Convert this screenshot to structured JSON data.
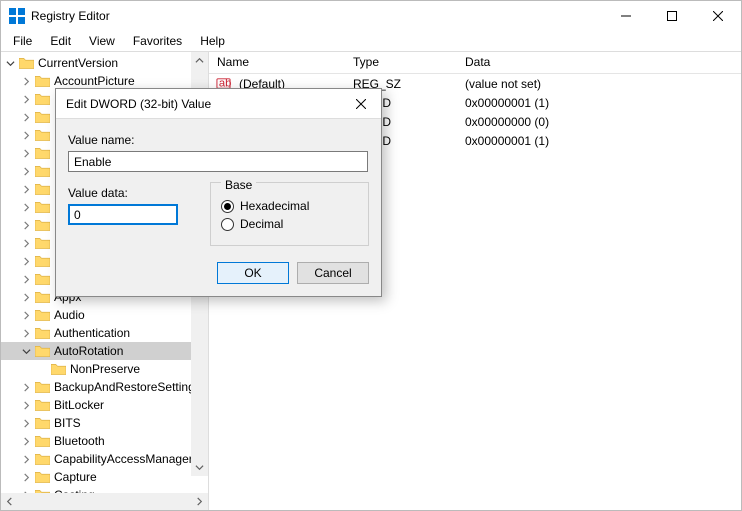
{
  "titlebar": {
    "title": "Registry Editor"
  },
  "menubar": {
    "file": "File",
    "edit": "Edit",
    "view": "View",
    "favorites": "Favorites",
    "help": "Help"
  },
  "tree": {
    "root_label": "CurrentVersion",
    "items": [
      "AccountPicture",
      "",
      "",
      "",
      "",
      "",
      "",
      "",
      "",
      "",
      "",
      "",
      "Appx",
      "Audio",
      "Authentication",
      "AutoRotation",
      "BackupAndRestoreSettings",
      "BitLocker",
      "BITS",
      "Bluetooth",
      "CapabilityAccessManager",
      "Capture",
      "Casting"
    ],
    "auto_rotation_children": [
      "NonPreserve"
    ]
  },
  "list": {
    "columns": {
      "name": "Name",
      "type": "Type",
      "data": "Data"
    },
    "rows": [
      {
        "name": "(Default)",
        "type": "REG_SZ",
        "data": "(value not set)",
        "icon": "string"
      },
      {
        "name": "",
        "type": "WORD",
        "data": "0x00000001 (1)",
        "icon": ""
      },
      {
        "name": "",
        "type": "WORD",
        "data": "0x00000000 (0)",
        "icon": ""
      },
      {
        "name": "",
        "type": "WORD",
        "data": "0x00000001 (1)",
        "icon": ""
      }
    ]
  },
  "dialog": {
    "title": "Edit DWORD (32-bit) Value",
    "value_name_label": "Value name:",
    "value_name": "Enable",
    "value_data_label": "Value data:",
    "value_data": "0",
    "base_label": "Base",
    "hex_label": "Hexadecimal",
    "dec_label": "Decimal",
    "ok": "OK",
    "cancel": "Cancel"
  },
  "colors": {
    "accent": "#0078d7",
    "folder": "#ffd86b",
    "folder_stroke": "#d6a93e"
  }
}
